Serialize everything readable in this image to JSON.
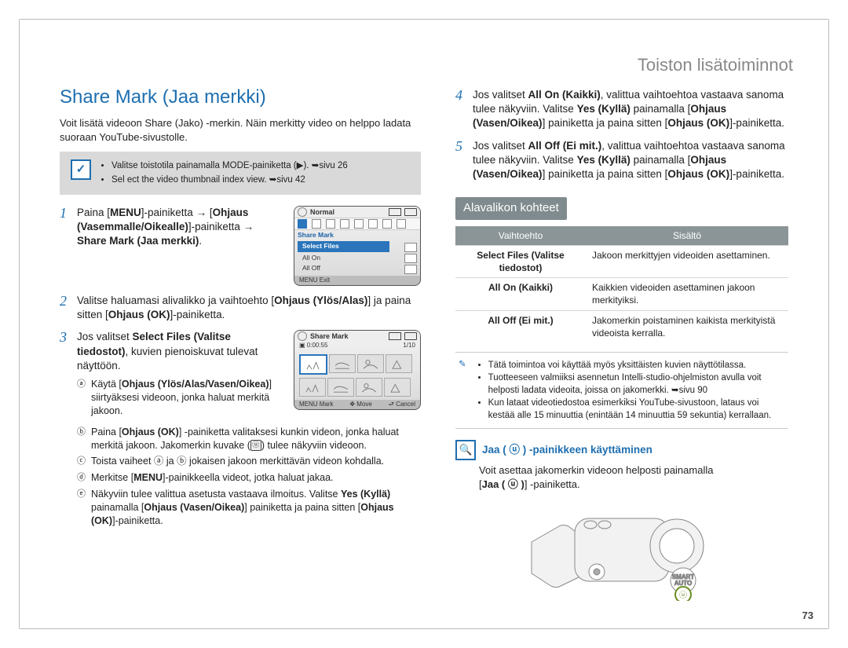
{
  "header": {
    "breadcrumb": "Toiston lisätoiminnot"
  },
  "section": {
    "title": "Share Mark (Jaa merkki)",
    "intro": "Voit lisätä videoon Share (Jako) -merkin. Näin merkitty video on helppo ladata suoraan YouTube-sivustolle.",
    "notebox": {
      "icon": "✓",
      "items": [
        "Valitse toistotila painamalla MODE-painiketta (▶). ➥sivu 26",
        "Sel ect the video thumbnail index view. ➥sivu 42"
      ]
    }
  },
  "steps": {
    "1": {
      "text_parts": {
        "a": "Paina [",
        "b": "MENU",
        "c": "]-painiketta → [",
        "d": "Ohjaus (Vasemmalle/Oikealle)",
        "e": "]-painiketta → ",
        "f": "Share Mark (Jaa merkki)",
        "g": "."
      }
    },
    "2": {
      "text_parts": {
        "a": "Valitse haluamasi alivalikko ja vaihtoehto [",
        "b": "Ohjaus (Ylös/Alas)",
        "c": "] ja paina sitten [",
        "d": "Ohjaus (OK)",
        "e": "]-painiketta."
      }
    },
    "3": {
      "intro_parts": {
        "a": "Jos valitset ",
        "b": "Select Files (Valitse tiedostot)",
        "c": ", kuvien pienoiskuvat tulevat näyttöön."
      },
      "subs": {
        "a": "Käytä [Ohjaus (Ylös/Alas/Vasen/Oikea)] siirtyäksesi videoon, jonka haluat merkitä jakoon.",
        "b": "Paina [Ohjaus (OK)] -painiketta valitaksesi kunkin videon, jonka haluat merkitä jakoon. Jakomerkin kuvake (ⓤ) tulee näkyviin videoon.",
        "c": "Toista vaiheet ⓐ ja ⓑ jokaisen jakoon merkittävän videon kohdalla.",
        "d": "Merkitse [MENU]-painikkeella videot, jotka haluat jakaa.",
        "e": "Näkyviin tulee valittua asetusta vastaava ilmoitus. Valitse Yes (Kyllä) painamalla [Ohjaus (Vasen/Oikea)] painiketta ja paina sitten [Ohjaus (OK)]-painiketta."
      }
    },
    "4": {
      "text_parts": {
        "a": "Jos valitset ",
        "b": "All On (Kaikki)",
        "c": ", valittua vaihtoehtoa vastaava sanoma tulee näkyviin. Valitse ",
        "d": "Yes (Kyllä)",
        "e": " painamalla [",
        "f": "Ohjaus (Vasen/Oikea)",
        "g": "] painiketta ja paina sitten [",
        "h": "Ohjaus (OK)",
        "i": "]-painiketta."
      }
    },
    "5": {
      "text_parts": {
        "a": "Jos valitset ",
        "b": "All Off (Ei mit.)",
        "c": ", valittua vaihtoehtoa vastaava sanoma tulee näkyviin. Valitse ",
        "d": "Yes (Kyllä)",
        "e": " painamalla [",
        "f": "Ohjaus (Vasen/Oikea)",
        "g": "] painiketta ja paina sitten [",
        "h": "Ohjaus (OK)",
        "i": "]-painiketta."
      }
    }
  },
  "screenshot1": {
    "normal": "Normal",
    "brand": "◎",
    "title": "Share Mark",
    "selected": "Select Files",
    "opt1": "All On",
    "opt2": "All Off",
    "bottom_left": "MENU Exit"
  },
  "screenshot2": {
    "title": "Share Mark",
    "time": "0:00:55",
    "counter": "1/10",
    "bottom_left": "MENU Mark",
    "bottom_mid": "✥ Move",
    "bottom_right": "⮐ Cancel"
  },
  "submenu": {
    "heading": "Alavalikon kohteet",
    "th1": "Vaihtoehto",
    "th2": "Sisältö",
    "rows": [
      {
        "k": "Select Files (Valitse tiedostot)",
        "v": "Jakoon merkittyjen videoiden asettaminen."
      },
      {
        "k": "All On (Kaikki)",
        "v": "Kaikkien videoiden asettaminen jakoon merkityiksi."
      },
      {
        "k": "All Off (Ei mit.)",
        "v": "Jakomerkin poistaminen kaikista merkityistä videoista kerralla."
      }
    ]
  },
  "infobox": {
    "icon": "✎",
    "items": [
      "Tätä toimintoa voi käyttää myös yksittäisten kuvien näyttötilassa.",
      "Tuotteeseen valmiiksi asennetun Intelli-studio-ohjelmiston avulla voit helposti ladata videoita, joissa on jakomerkki. ➥sivu 90",
      "Kun lataat videotiedostoa esimerkiksi YouTube-sivustoon, lataus voi kestää alle 15 minuuttia (enintään 14 minuuttia 59 sekuntia) kerrallaan."
    ]
  },
  "share_button": {
    "icon": "🔍",
    "title": "Jaa ( ⓤ ) -painikkeen käyttäminen",
    "text": "Voit asettaa jakomerkin videoon helposti painamalla [Jaa ( ⓤ )] -painiketta."
  },
  "page_number": "73"
}
